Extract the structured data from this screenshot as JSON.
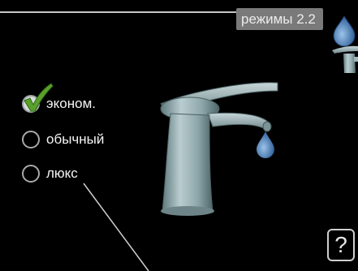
{
  "header": {
    "title": "режимы 2.2"
  },
  "options": [
    {
      "label": "эконом.",
      "selected": true
    },
    {
      "label": "обычный",
      "selected": false
    },
    {
      "label": "люкс",
      "selected": false
    }
  ],
  "help": {
    "label": "?"
  },
  "icons": {
    "check": "checkmark-icon",
    "faucet": "faucet-illustration",
    "drop": "water-drop-icon",
    "side_tap": "tap-icon"
  },
  "colors": {
    "check_green": "#5aa02c",
    "drop_blue": "#3d6fa8",
    "faucet_steel": "#8fa9ad"
  }
}
